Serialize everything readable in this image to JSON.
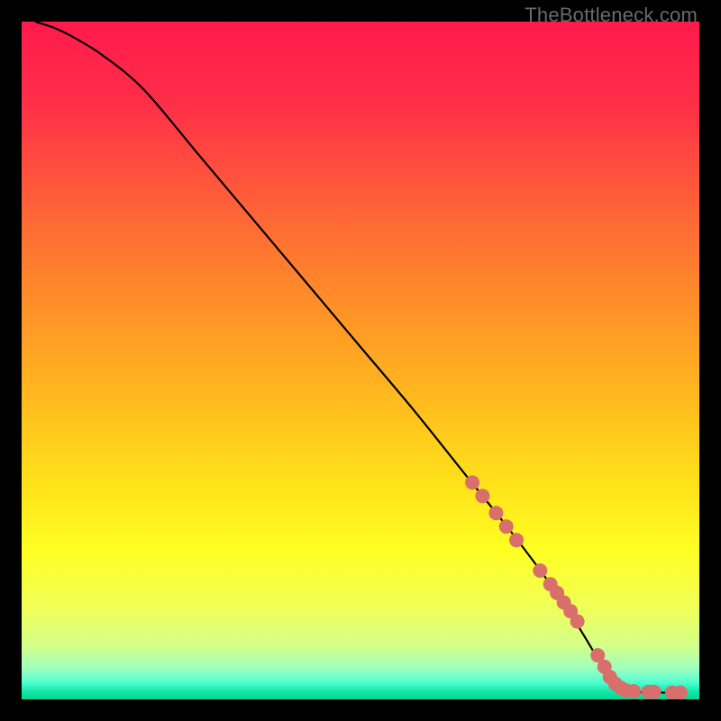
{
  "watermark": {
    "text": "TheBottleneck.com"
  },
  "gradient": {
    "stops": [
      {
        "offset": 0.0,
        "color": "#ff1a4d"
      },
      {
        "offset": 0.12,
        "color": "#ff2e48"
      },
      {
        "offset": 0.25,
        "color": "#ff5a3a"
      },
      {
        "offset": 0.4,
        "color": "#ff8a2a"
      },
      {
        "offset": 0.55,
        "color": "#ffb81f"
      },
      {
        "offset": 0.68,
        "color": "#ffe11a"
      },
      {
        "offset": 0.78,
        "color": "#ffff22"
      },
      {
        "offset": 0.86,
        "color": "#f2ff55"
      },
      {
        "offset": 0.92,
        "color": "#d4ff88"
      },
      {
        "offset": 0.955,
        "color": "#9fffc0"
      },
      {
        "offset": 0.975,
        "color": "#4fffd0"
      },
      {
        "offset": 0.988,
        "color": "#12e8a8"
      },
      {
        "offset": 1.0,
        "color": "#07d494"
      }
    ]
  },
  "chart_data": {
    "type": "line",
    "title": "",
    "xlabel": "",
    "ylabel": "",
    "xlim": [
      0,
      100
    ],
    "ylim": [
      0,
      100
    ],
    "note": "Values read from pixel positions; curve descends from top-left toward bottom-right, inflects to near-zero around x≈87 then runs flat along the bottom.",
    "series": [
      {
        "name": "curve",
        "x": [
          2,
          5,
          8,
          12,
          18,
          26,
          34,
          42,
          50,
          58,
          66,
          72,
          78,
          82,
          85,
          87,
          90,
          94,
          98
        ],
        "y": [
          100,
          99,
          97.5,
          95,
          90,
          80.5,
          71,
          61.5,
          52,
          42.5,
          32.5,
          25,
          17,
          11,
          6,
          2.5,
          1.2,
          1.0,
          1.0
        ]
      },
      {
        "name": "markers",
        "type": "scatter",
        "marker_color": "#d86f6a",
        "marker_radius": 8,
        "x": [
          66.5,
          68.0,
          70.0,
          71.5,
          73.0,
          76.5,
          78.0,
          79.0,
          80.0,
          81.0,
          82.0,
          85.0,
          86.0,
          86.8,
          87.6,
          88.4,
          89.2,
          90.3,
          92.5,
          93.3,
          96.0,
          97.2
        ],
        "y": [
          32.0,
          30.0,
          27.5,
          25.5,
          23.5,
          19.0,
          17.0,
          15.7,
          14.3,
          13.0,
          11.5,
          6.5,
          4.8,
          3.3,
          2.3,
          1.7,
          1.3,
          1.2,
          1.1,
          1.1,
          1.0,
          1.0
        ]
      }
    ]
  }
}
